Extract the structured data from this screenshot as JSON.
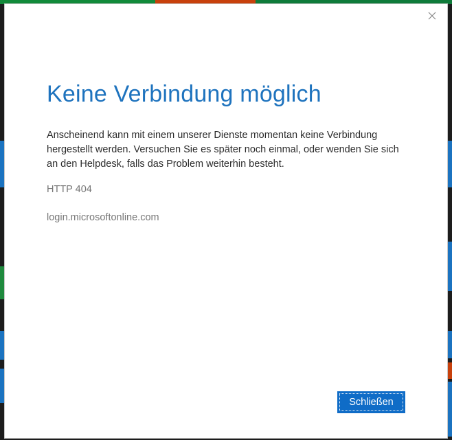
{
  "dialog": {
    "title": "Keine Verbindung möglich",
    "message": "Anscheinend kann mit einem unserer Dienste momentan keine Verbindung hergestellt werden. Versuchen Sie es später noch einmal, oder wenden Sie sich an den Helpdesk, falls das Problem weiterhin besteht.",
    "status_code": "HTTP 404",
    "host": "login.microsoftonline.com",
    "close_button_label": "Schließen",
    "close_icon": "close-icon"
  },
  "background": {
    "strip_colors": [
      "#0e7a0d",
      "#c7430f",
      "#1b73c0",
      "#1b73c0"
    ]
  }
}
